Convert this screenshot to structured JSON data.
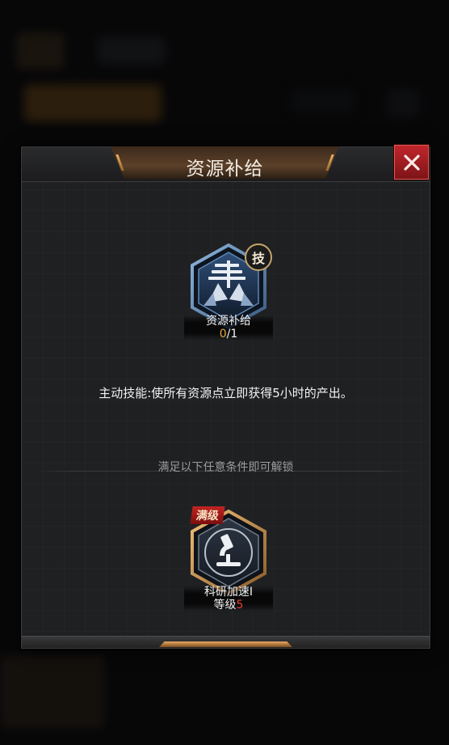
{
  "dialog": {
    "title": "资源补给"
  },
  "skill": {
    "name": "资源补给",
    "progress_current": "0",
    "progress_total": "/1",
    "tag": "技",
    "description": "主动技能:使所有资源点立即获得5小时的产出。"
  },
  "condition": {
    "header": "满足以下任意条件即可解锁",
    "item_name": "科研加速I",
    "level_label": "等级",
    "level_value": "5",
    "max_tag": "满级"
  },
  "colors": {
    "accent_gold": "#e8a53d",
    "close_red": "#c0262b",
    "level_red": "#e83b36"
  },
  "icons": [
    "close-icon",
    "resource-supply-icon",
    "microscope-icon"
  ]
}
